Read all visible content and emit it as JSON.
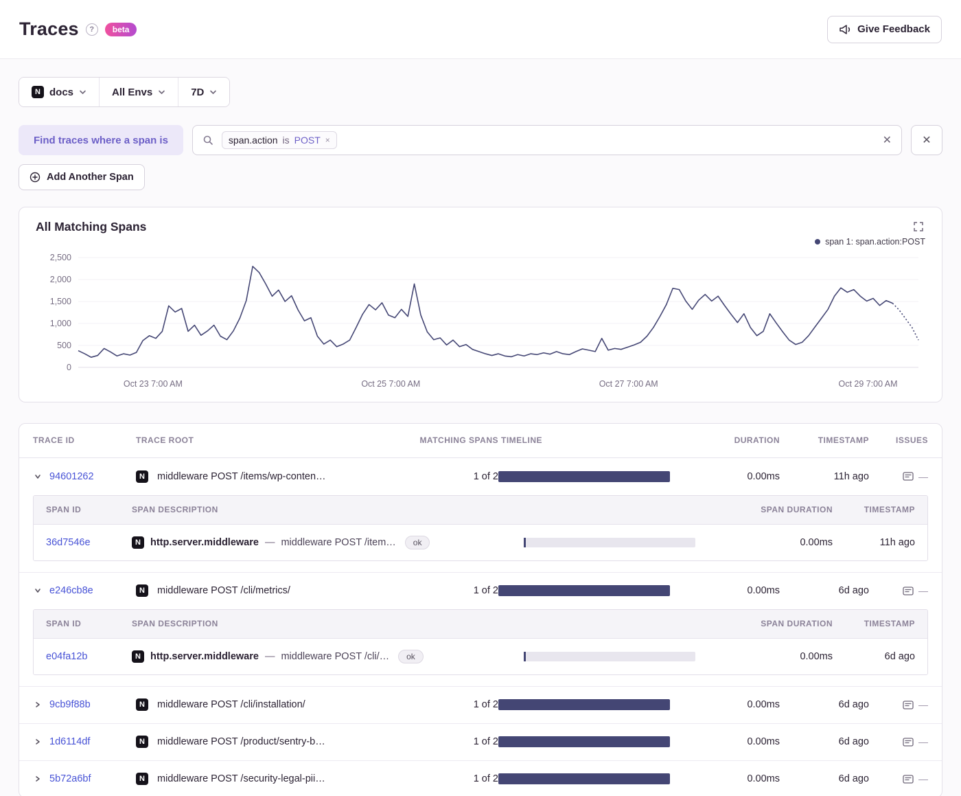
{
  "header": {
    "title": "Traces",
    "beta": "beta",
    "feedback": "Give Feedback"
  },
  "icons": {
    "help": "?",
    "close": "✕",
    "token_remove": "×"
  },
  "filters": {
    "project": "docs",
    "environment": "All Envs",
    "period": "7D"
  },
  "search": {
    "find_label": "Find traces where a span is",
    "token": {
      "key": "span.action",
      "operator": "is",
      "value": "POST"
    },
    "add_span": "Add Another Span"
  },
  "chart": {
    "title": "All Matching Spans",
    "legend": "span 1: span.action:POST"
  },
  "chart_data": {
    "type": "line",
    "title": "All Matching Spans",
    "series_name": "span 1: span.action:POST",
    "line_color": "#444674",
    "ylim": [
      0,
      2500
    ],
    "yticks": [
      {
        "v": 0,
        "label": "0"
      },
      {
        "v": 500,
        "label": "500"
      },
      {
        "v": 1000,
        "label": "1,000"
      },
      {
        "v": 1500,
        "label": "1,500"
      },
      {
        "v": 2000,
        "label": "2,000"
      },
      {
        "v": 2500,
        "label": "2,500"
      }
    ],
    "xticks": [
      {
        "f": 0.089,
        "label": "Oct 23 7:00 AM"
      },
      {
        "f": 0.372,
        "label": "Oct 25 7:00 AM"
      },
      {
        "f": 0.655,
        "label": "Oct 27 7:00 AM"
      },
      {
        "f": 0.94,
        "label": "Oct 29 7:00 AM"
      }
    ],
    "values": [
      380,
      310,
      230,
      270,
      430,
      350,
      260,
      310,
      280,
      340,
      610,
      720,
      660,
      820,
      1400,
      1260,
      1340,
      820,
      960,
      730,
      830,
      960,
      710,
      630,
      830,
      1120,
      1520,
      2300,
      2160,
      1900,
      1620,
      1760,
      1500,
      1630,
      1310,
      1060,
      1130,
      710,
      530,
      620,
      470,
      530,
      620,
      910,
      1210,
      1430,
      1310,
      1470,
      1190,
      1130,
      1320,
      1160,
      1900,
      1190,
      810,
      630,
      670,
      510,
      620,
      470,
      520,
      410,
      360,
      310,
      270,
      310,
      260,
      240,
      290,
      260,
      310,
      290,
      330,
      300,
      360,
      310,
      290,
      360,
      420,
      390,
      360,
      660,
      390,
      430,
      410,
      460,
      510,
      570,
      710,
      910,
      1160,
      1430,
      1800,
      1770,
      1510,
      1320,
      1530,
      1660,
      1510,
      1620,
      1410,
      1210,
      1020,
      1220,
      910,
      720,
      820,
      1220,
      1010,
      810,
      620,
      520,
      570,
      720,
      920,
      1120,
      1320,
      1620,
      1810,
      1710,
      1770,
      1620,
      1510,
      1570,
      1410,
      1520,
      1460,
      1310,
      1110,
      910,
      620
    ]
  },
  "table": {
    "columns": [
      "TRACE ID",
      "TRACE ROOT",
      "MATCHING SPANS",
      "TIMELINE",
      "DURATION",
      "TIMESTAMP",
      "ISSUES"
    ],
    "span_columns": [
      "SPAN ID",
      "SPAN DESCRIPTION",
      "SPAN DURATION",
      "TIMESTAMP"
    ],
    "span_separator": "—",
    "issues_placeholder": "—",
    "platform_letter": "N",
    "rows": [
      {
        "id": "94601262",
        "expanded": true,
        "root": "middleware POST /items/wp-conten…",
        "matching": "1 of 2",
        "duration": "0.00ms",
        "timestamp": "11h ago",
        "spans": [
          {
            "id": "36d7546e",
            "op": "http.server.middleware",
            "desc": "middleware POST /item…",
            "status": "ok",
            "duration": "0.00ms",
            "timestamp": "11h ago"
          }
        ]
      },
      {
        "id": "e246cb8e",
        "expanded": true,
        "root": "middleware POST /cli/metrics/",
        "matching": "1 of 2",
        "duration": "0.00ms",
        "timestamp": "6d ago",
        "spans": [
          {
            "id": "e04fa12b",
            "op": "http.server.middleware",
            "desc": "middleware POST /cli/…",
            "status": "ok",
            "duration": "0.00ms",
            "timestamp": "6d ago"
          }
        ]
      },
      {
        "id": "9cb9f88b",
        "expanded": false,
        "root": "middleware POST /cli/installation/",
        "matching": "1 of 2",
        "duration": "0.00ms",
        "timestamp": "6d ago"
      },
      {
        "id": "1d6114df",
        "expanded": false,
        "root": "middleware POST /product/sentry-b…",
        "matching": "1 of 2",
        "duration": "0.00ms",
        "timestamp": "6d ago"
      },
      {
        "id": "5b72a6bf",
        "expanded": false,
        "root": "middleware POST /security-legal-pii…",
        "matching": "1 of 2",
        "duration": "0.00ms",
        "timestamp": "6d ago"
      }
    ]
  },
  "colors": {
    "accent_purple": "#6c5fc7",
    "link_blue": "#4752d6",
    "timeline_bar": "#444674",
    "purple_bg": "#ece8f9"
  }
}
